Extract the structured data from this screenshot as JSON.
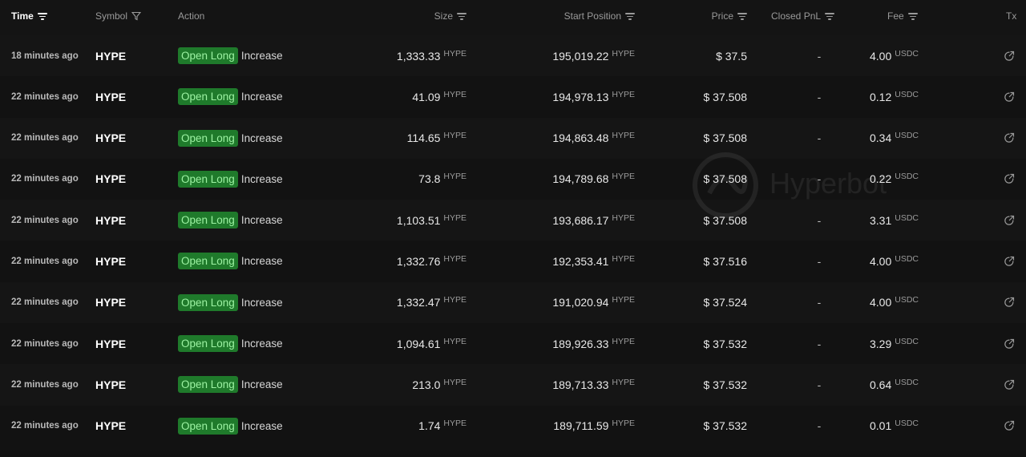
{
  "header": {
    "time": "Time",
    "symbol": "Symbol",
    "action": "Action",
    "size": "Size",
    "start_position": "Start Position",
    "price": "Price",
    "closed_pnl": "Closed PnL",
    "fee": "Fee",
    "tx": "Tx"
  },
  "rows": [
    {
      "time": "18 minutes ago",
      "symbol": "HYPE",
      "badge": "Open Long",
      "action": "Increase",
      "size": "1,333.33",
      "size_unit": "HYPE",
      "start_position": "195,019.22",
      "start_unit": "HYPE",
      "price": "$ 37.5",
      "pnl": "-",
      "fee": "4.00",
      "fee_unit": "USDC"
    },
    {
      "time": "22 minutes ago",
      "symbol": "HYPE",
      "badge": "Open Long",
      "action": "Increase",
      "size": "41.09",
      "size_unit": "HYPE",
      "start_position": "194,978.13",
      "start_unit": "HYPE",
      "price": "$ 37.508",
      "pnl": "-",
      "fee": "0.12",
      "fee_unit": "USDC"
    },
    {
      "time": "22 minutes ago",
      "symbol": "HYPE",
      "badge": "Open Long",
      "action": "Increase",
      "size": "114.65",
      "size_unit": "HYPE",
      "start_position": "194,863.48",
      "start_unit": "HYPE",
      "price": "$ 37.508",
      "pnl": "-",
      "fee": "0.34",
      "fee_unit": "USDC"
    },
    {
      "time": "22 minutes ago",
      "symbol": "HYPE",
      "badge": "Open Long",
      "action": "Increase",
      "size": "73.8",
      "size_unit": "HYPE",
      "start_position": "194,789.68",
      "start_unit": "HYPE",
      "price": "$ 37.508",
      "pnl": "-",
      "fee": "0.22",
      "fee_unit": "USDC"
    },
    {
      "time": "22 minutes ago",
      "symbol": "HYPE",
      "badge": "Open Long",
      "action": "Increase",
      "size": "1,103.51",
      "size_unit": "HYPE",
      "start_position": "193,686.17",
      "start_unit": "HYPE",
      "price": "$ 37.508",
      "pnl": "-",
      "fee": "3.31",
      "fee_unit": "USDC"
    },
    {
      "time": "22 minutes ago",
      "symbol": "HYPE",
      "badge": "Open Long",
      "action": "Increase",
      "size": "1,332.76",
      "size_unit": "HYPE",
      "start_position": "192,353.41",
      "start_unit": "HYPE",
      "price": "$ 37.516",
      "pnl": "-",
      "fee": "4.00",
      "fee_unit": "USDC"
    },
    {
      "time": "22 minutes ago",
      "symbol": "HYPE",
      "badge": "Open Long",
      "action": "Increase",
      "size": "1,332.47",
      "size_unit": "HYPE",
      "start_position": "191,020.94",
      "start_unit": "HYPE",
      "price": "$ 37.524",
      "pnl": "-",
      "fee": "4.00",
      "fee_unit": "USDC"
    },
    {
      "time": "22 minutes ago",
      "symbol": "HYPE",
      "badge": "Open Long",
      "action": "Increase",
      "size": "1,094.61",
      "size_unit": "HYPE",
      "start_position": "189,926.33",
      "start_unit": "HYPE",
      "price": "$ 37.532",
      "pnl": "-",
      "fee": "3.29",
      "fee_unit": "USDC"
    },
    {
      "time": "22 minutes ago",
      "symbol": "HYPE",
      "badge": "Open Long",
      "action": "Increase",
      "size": "213.0",
      "size_unit": "HYPE",
      "start_position": "189,713.33",
      "start_unit": "HYPE",
      "price": "$ 37.532",
      "pnl": "-",
      "fee": "0.64",
      "fee_unit": "USDC"
    },
    {
      "time": "22 minutes ago",
      "symbol": "HYPE",
      "badge": "Open Long",
      "action": "Increase",
      "size": "1.74",
      "size_unit": "HYPE",
      "start_position": "189,711.59",
      "start_unit": "HYPE",
      "price": "$ 37.532",
      "pnl": "-",
      "fee": "0.01",
      "fee_unit": "USDC"
    }
  ],
  "icons": {
    "sort": "sort-lines-icon",
    "filter": "funnel-filter-icon",
    "tx": "external-link-icon"
  },
  "colors": {
    "background": "#121212",
    "badge_bg": "#1f7a2b",
    "badge_text": "#9cf2a2",
    "muted": "#9a9a9a"
  }
}
